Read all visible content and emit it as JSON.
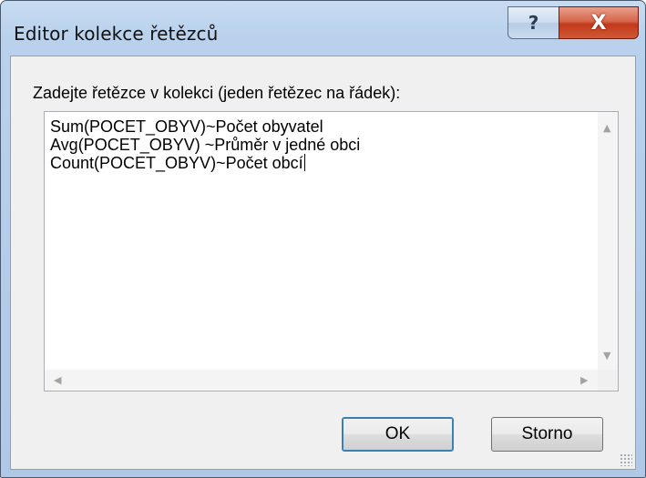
{
  "window": {
    "title": "Editor kolekce řetězců",
    "help_glyph": "?",
    "close_glyph": "X"
  },
  "dialog": {
    "prompt": "Zadejte řetězce v kolekci (jeden řetězec na řádek):",
    "lines": [
      "Sum(POCET_OBYV)~Počet obyvatel",
      "Avg(POCET_OBYV) ~Průměr v jedné obci",
      "Count(POCET_OBYV)~Počet obcí"
    ],
    "ok_label": "OK",
    "cancel_label": "Storno"
  },
  "icons": {
    "scroll_up": "up-arrow-icon",
    "scroll_down": "down-arrow-icon",
    "scroll_left": "left-arrow-icon",
    "scroll_right": "right-arrow-icon",
    "resize_grip": "resize-grip-icon"
  },
  "colors": {
    "frame": "#b9d1ec",
    "close_button": "#c2381a",
    "client_bg": "#f0f0f0",
    "default_button_border": "#3c7fb1"
  }
}
